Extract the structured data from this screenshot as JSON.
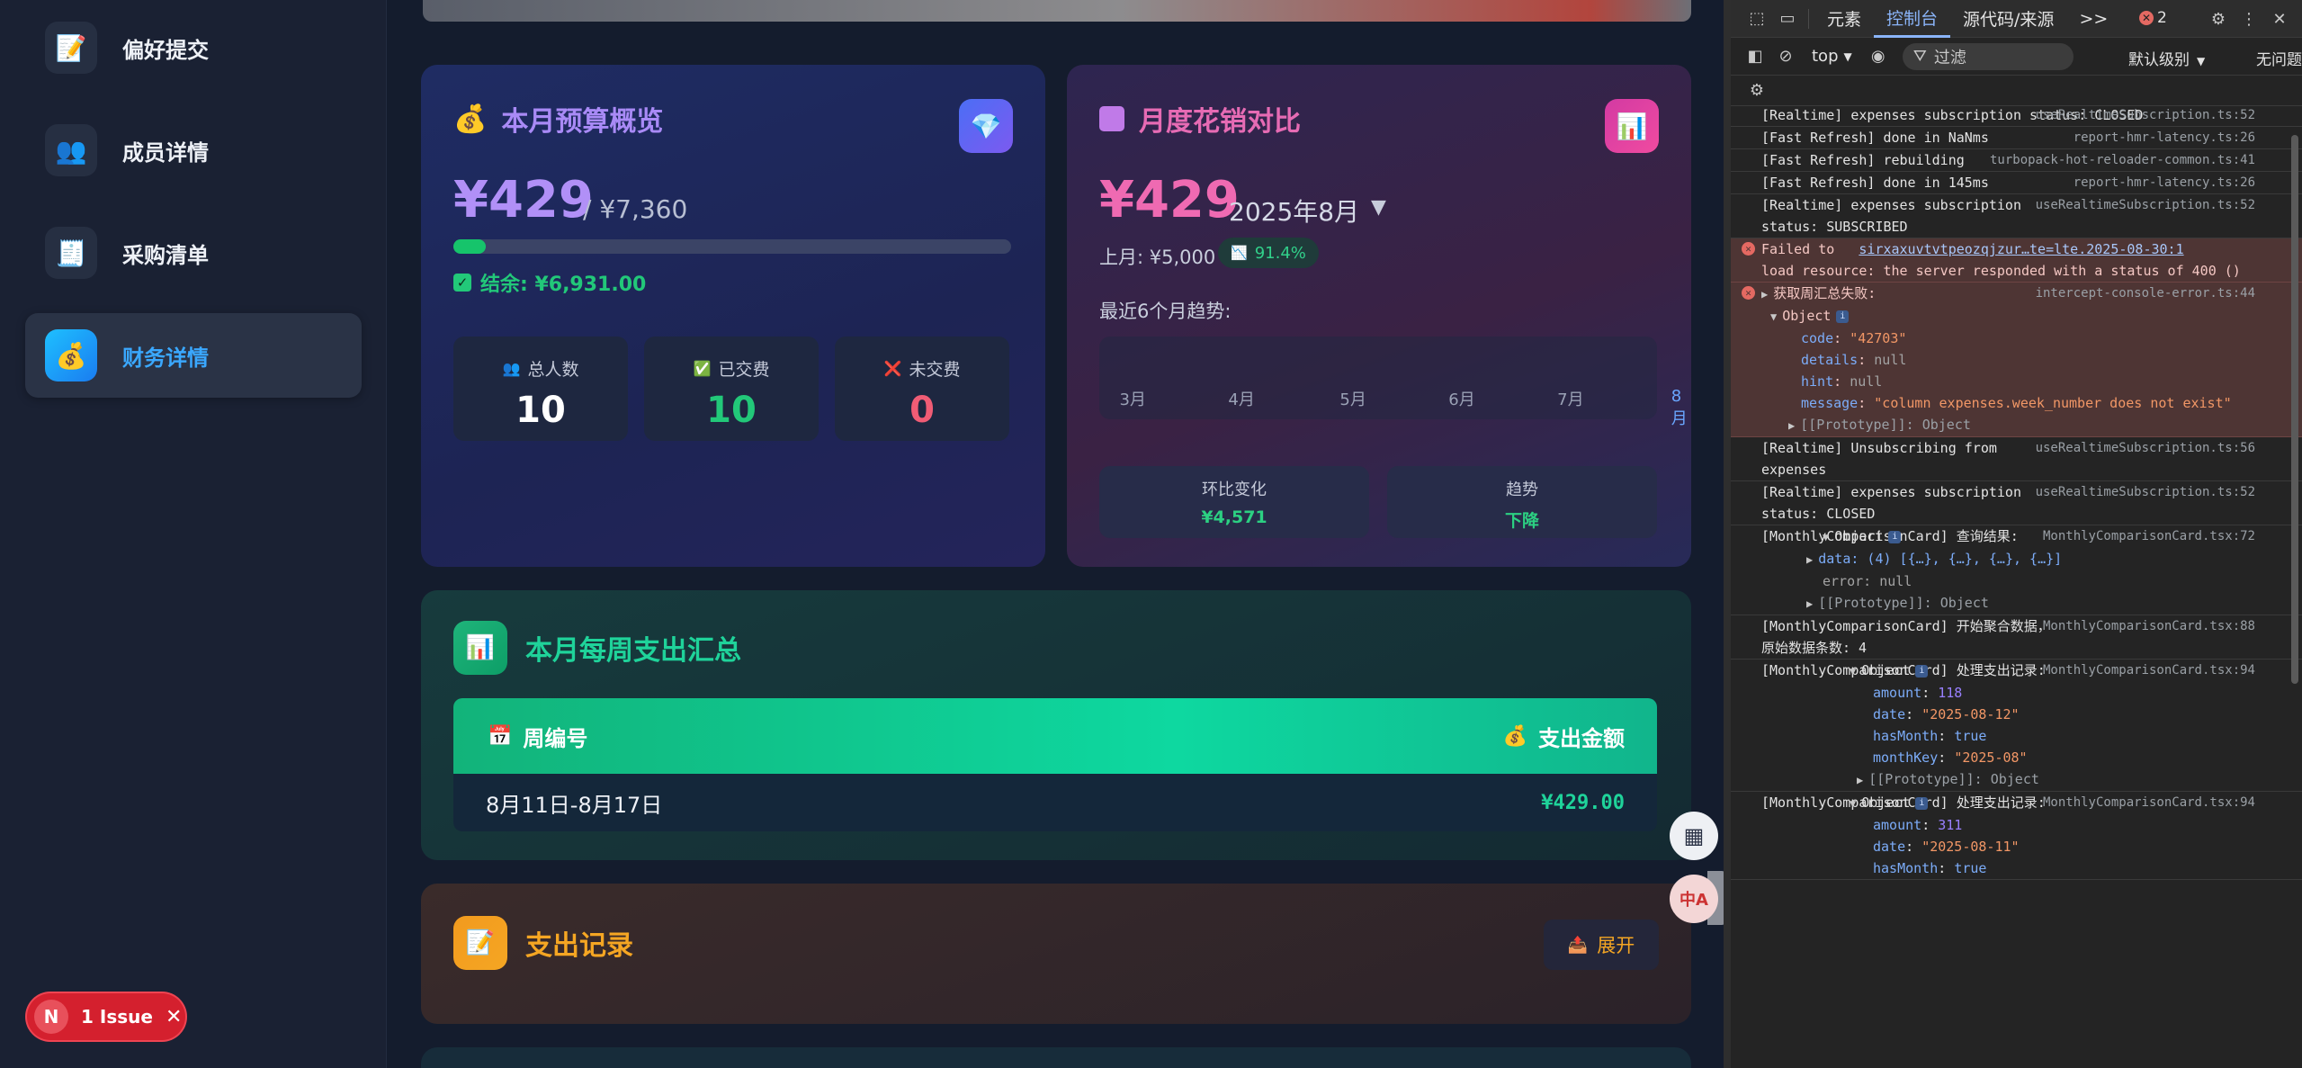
{
  "sidebar": {
    "items": [
      {
        "label": "偏好提交",
        "icon": "📝"
      },
      {
        "label": "成员详情",
        "icon": "👥"
      },
      {
        "label": "采购清单",
        "icon": "🧾"
      },
      {
        "label": "财务详情",
        "icon": "💰"
      }
    ],
    "active_index": 3,
    "issue_badge": {
      "letter": "N",
      "text": "1 Issue",
      "close": "✕"
    }
  },
  "budget_card": {
    "title": "本月预算概览",
    "title_icon": "💰",
    "badge_icon": "💎",
    "spent": "¥429",
    "total": "/ ¥7,360",
    "progress_fraction": 0.058,
    "surplus": "结余: ¥6,931.00",
    "stats": [
      {
        "label": "总人数",
        "value": "10",
        "icon": "👥",
        "color": "#ffffff"
      },
      {
        "label": "已交费",
        "value": "10",
        "icon": "✅",
        "color": "#22c879"
      },
      {
        "label": "未交费",
        "value": "0",
        "icon": "❌",
        "color": "#f05c75"
      }
    ]
  },
  "compare_card": {
    "title": "月度花销对比",
    "badge_icon": "📊",
    "amount": "¥429",
    "month": "2025年8月",
    "caret": "▼",
    "last_month": "上月: ¥5,000",
    "change": "91.4%",
    "change_icon": "📉",
    "trend_title": "最近6个月趋势:",
    "trend_months": [
      "3月",
      "4月",
      "5月",
      "6月",
      "7月",
      "8月"
    ],
    "mom_label": "环比变化",
    "mom_value": "¥4,571",
    "trend_label": "趋势",
    "trend_value": "下降"
  },
  "weekly_card": {
    "title": "本月每周支出汇总",
    "icon": "📊",
    "col_week": "周编号",
    "col_week_icon": "📅",
    "col_amount": "支出金额",
    "col_amount_icon": "💰",
    "rows": [
      {
        "week": "8月11日-8月17日",
        "amount": "¥429.00"
      }
    ]
  },
  "records_card": {
    "title": "支出记录",
    "icon": "📝",
    "expand_label": "展开",
    "expand_icon": "📤"
  },
  "floating": {
    "qr_icon": "▦",
    "translate_icon": "中A"
  },
  "devtools": {
    "tabs": [
      "元素",
      "控制台",
      "源代码/来源"
    ],
    "active_tab": "控制台",
    "more": ">>",
    "error_count": "2",
    "context": "top",
    "filter_placeholder": "过滤",
    "level": "默认级别",
    "no_issues": "无问题",
    "logs": [
      {
        "text": "[Realtime] expenses subscription status: CLOSED",
        "src": "useRealtimeSubscription.ts:52"
      },
      {
        "text": "[Fast Refresh] done in NaNms",
        "src": "report-hmr-latency.ts:26"
      },
      {
        "text": "[Fast Refresh] rebuilding",
        "src": "turbopack-hot-reloader-common.ts:41"
      },
      {
        "text": "[Fast Refresh] done in 145ms",
        "src": "report-hmr-latency.ts:26"
      },
      {
        "text": "[Realtime] expenses subscription status: SUBSCRIBED",
        "src": "useRealtimeSubscription.ts:52"
      }
    ],
    "error1": {
      "prefix": "Failed to",
      "link": "sirxaxuvtvtpeozqjzur…te=lte.2025-08-30:1",
      "rest": "load resource: the server responded with a status of 400 ()"
    },
    "error2": {
      "title": "获取周汇总失败:",
      "src": "intercept-console-error.ts:44",
      "object": "Object",
      "code_key": "code",
      "code_val": "\"42703\"",
      "details_key": "details",
      "details_val": "null",
      "hint_key": "hint",
      "hint_val": "null",
      "message_key": "message",
      "message_val": "\"column expenses.week_number does not exist\"",
      "proto": "[[Prototype]]: Object"
    },
    "logs2": [
      {
        "text": "[Realtime] Unsubscribing from expenses",
        "src": "useRealtimeSubscription.ts:56"
      },
      {
        "text": "[Realtime] expenses subscription status: CLOSED",
        "src": "useRealtimeSubscription.ts:52"
      }
    ],
    "query_log": {
      "text": "[MonthlyComparisonCard] 查询结果:",
      "src": "MonthlyComparisonCard.tsx:72",
      "object": "Object",
      "data_line": "data: (4) [{…}, {…}, {…}, {…}]",
      "error_line": "error: null",
      "proto": "[[Prototype]]: Object"
    },
    "agg_log": {
      "text": "[MonthlyComparisonCard] 开始聚合数据，原始数据条数: 4",
      "src": "MonthlyComparisonCard.tsx:88"
    },
    "proc1": {
      "text": "[MonthlyComparisonCard] 处理支出记录:",
      "src": "MonthlyComparisonCard.tsx:94",
      "object": "Object",
      "amount": "118",
      "date": "\"2025-08-12\"",
      "hasMonth": "true",
      "monthKey": "\"2025-08\"",
      "proto": "[[Prototype]]: Object"
    },
    "proc2": {
      "text": "[MonthlyComparisonCard] 处理支出记录:",
      "src": "MonthlyComparisonCard.tsx:94",
      "object": "Object",
      "amount": "311",
      "date": "\"2025-08-11\"",
      "hasMonth": "true"
    }
  }
}
